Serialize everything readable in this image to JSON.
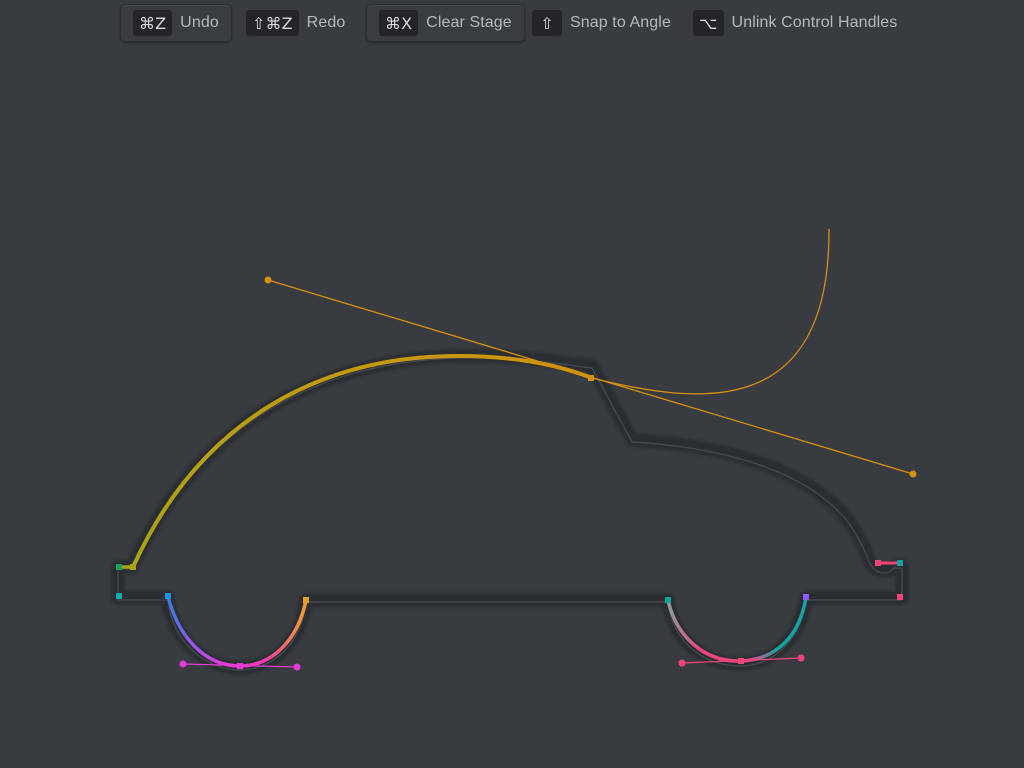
{
  "toolbar": {
    "items": [
      {
        "id": "undo",
        "key": "⌘Z",
        "label": "Undo",
        "icon": "command-z-key"
      },
      {
        "id": "redo",
        "key": "⇧⌘Z",
        "label": "Redo",
        "icon": "shift-command-z-key"
      },
      {
        "id": "clear",
        "key": "⌘X",
        "label": "Clear Stage",
        "icon": "command-x-key"
      },
      {
        "id": "snap",
        "key": "⇧",
        "label": "Snap to Angle",
        "icon": "shift-key"
      },
      {
        "id": "unlink",
        "key": "⌥",
        "label": "Unlink Control Handles",
        "icon": "option-key"
      }
    ]
  },
  "colors": {
    "background": "#383c40",
    "guide_shape": "#2f3236",
    "active_handle": "#d7900f",
    "path_start": "#a6a612",
    "wheel_magenta": "#e639d9",
    "wheel_pink": "#f04479",
    "segment_teal": "#0fa3a3",
    "segment_purple": "#8e5cf0"
  }
}
